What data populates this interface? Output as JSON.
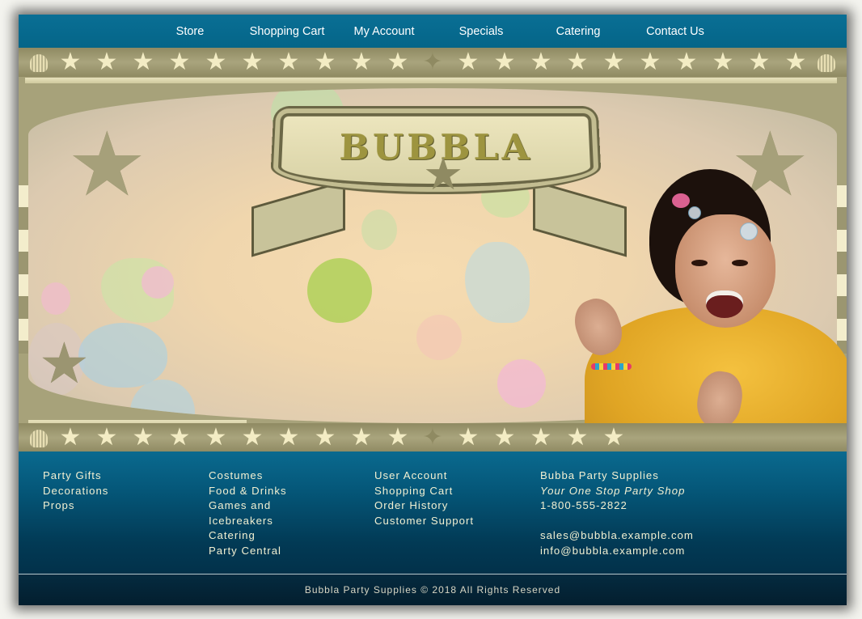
{
  "nav": {
    "items": [
      "Store",
      "Shopping Cart",
      "My Account",
      "Specials",
      "Catering",
      "Contact Us"
    ]
  },
  "banner": {
    "logo_text": "BUBBLA",
    "colors": {
      "frame": "#a7a27a",
      "star": "#f3ecc4",
      "logo_text": "#9d943f"
    }
  },
  "footer": {
    "col1": [
      "Party Gifts",
      "Decorations",
      "Props"
    ],
    "col2": [
      "Costumes",
      "Food & Drinks",
      "Games and",
      "Icebreakers",
      "Catering",
      "Party Central"
    ],
    "col3": [
      "User Account",
      "Shopping Cart",
      "Order History",
      "Customer Support"
    ],
    "contact": {
      "company": "Bubba Party Supplies",
      "tagline": "Your One Stop Party Shop",
      "phone": "1-800-555-2822",
      "email_sales": "sales@bubbla.example.com",
      "email_info": "info@bubbla.example.com"
    },
    "copyright": "Bubbla Party Supplies © 2018 All Rights Reserved"
  }
}
